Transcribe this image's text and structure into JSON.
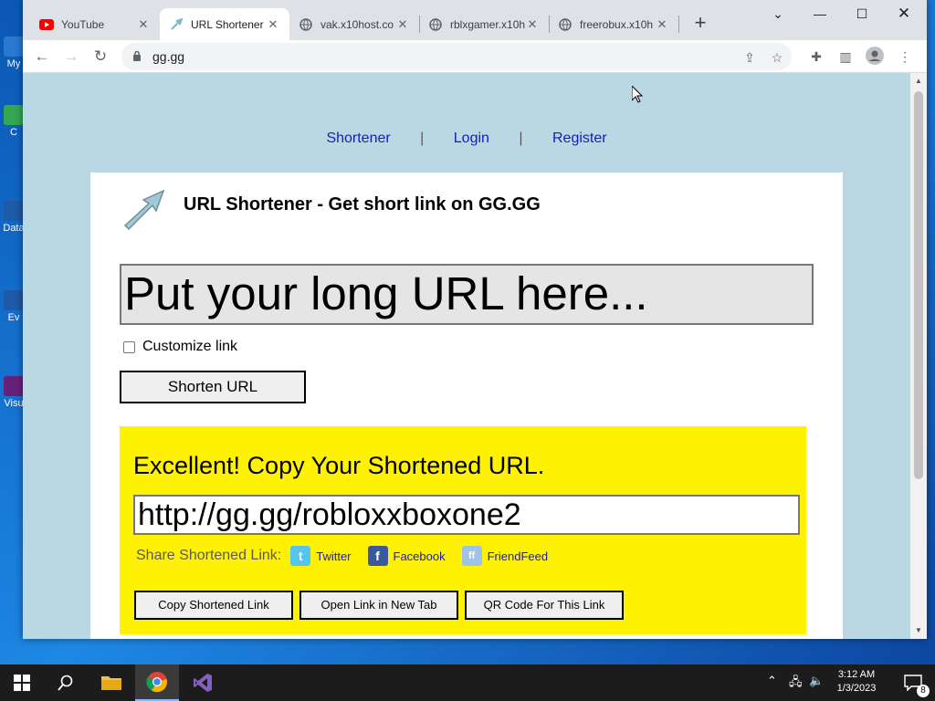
{
  "browser": {
    "tabs": [
      {
        "title": "YouTube",
        "favicon": "youtube-icon",
        "active": false
      },
      {
        "title": "URL Shortener",
        "favicon": "arrow-icon",
        "active": true
      },
      {
        "title": "vak.x10host.co",
        "favicon": "globe-icon",
        "active": false
      },
      {
        "title": "rblxgamer.x10h",
        "favicon": "globe-icon",
        "active": false
      },
      {
        "title": "freerobux.x10h",
        "favicon": "globe-icon",
        "active": false
      }
    ],
    "address": "gg.gg"
  },
  "page": {
    "nav": {
      "shortener": "Shortener",
      "login": "Login",
      "register": "Register"
    },
    "heading": "URL Shortener - Get short link on GG.GG",
    "long_url_placeholder": "Put your long URL here...",
    "customize_label": "Customize link",
    "shorten_button": "Shorten URL",
    "result": {
      "title": "Excellent! Copy Your Shortened URL.",
      "short_url": "http://gg.gg/robloxxboxone2",
      "share_label": "Share Shortened Link:",
      "share": {
        "twitter": "Twitter",
        "facebook": "Facebook",
        "friendfeed": "FriendFeed"
      },
      "copy_button": "Copy Shortened Link",
      "open_button": "Open Link in New Tab",
      "qr_button": "QR Code For This Link"
    }
  },
  "desktop": {
    "icons": [
      "My",
      "C",
      "Data",
      "Ev",
      "Visu"
    ]
  },
  "taskbar": {
    "time": "3:12 AM",
    "date": "1/3/2023",
    "notification_count": "8"
  },
  "colors": {
    "page_bg": "#bad8e4",
    "result_bg": "#fff200",
    "link": "#1a1ab8"
  }
}
